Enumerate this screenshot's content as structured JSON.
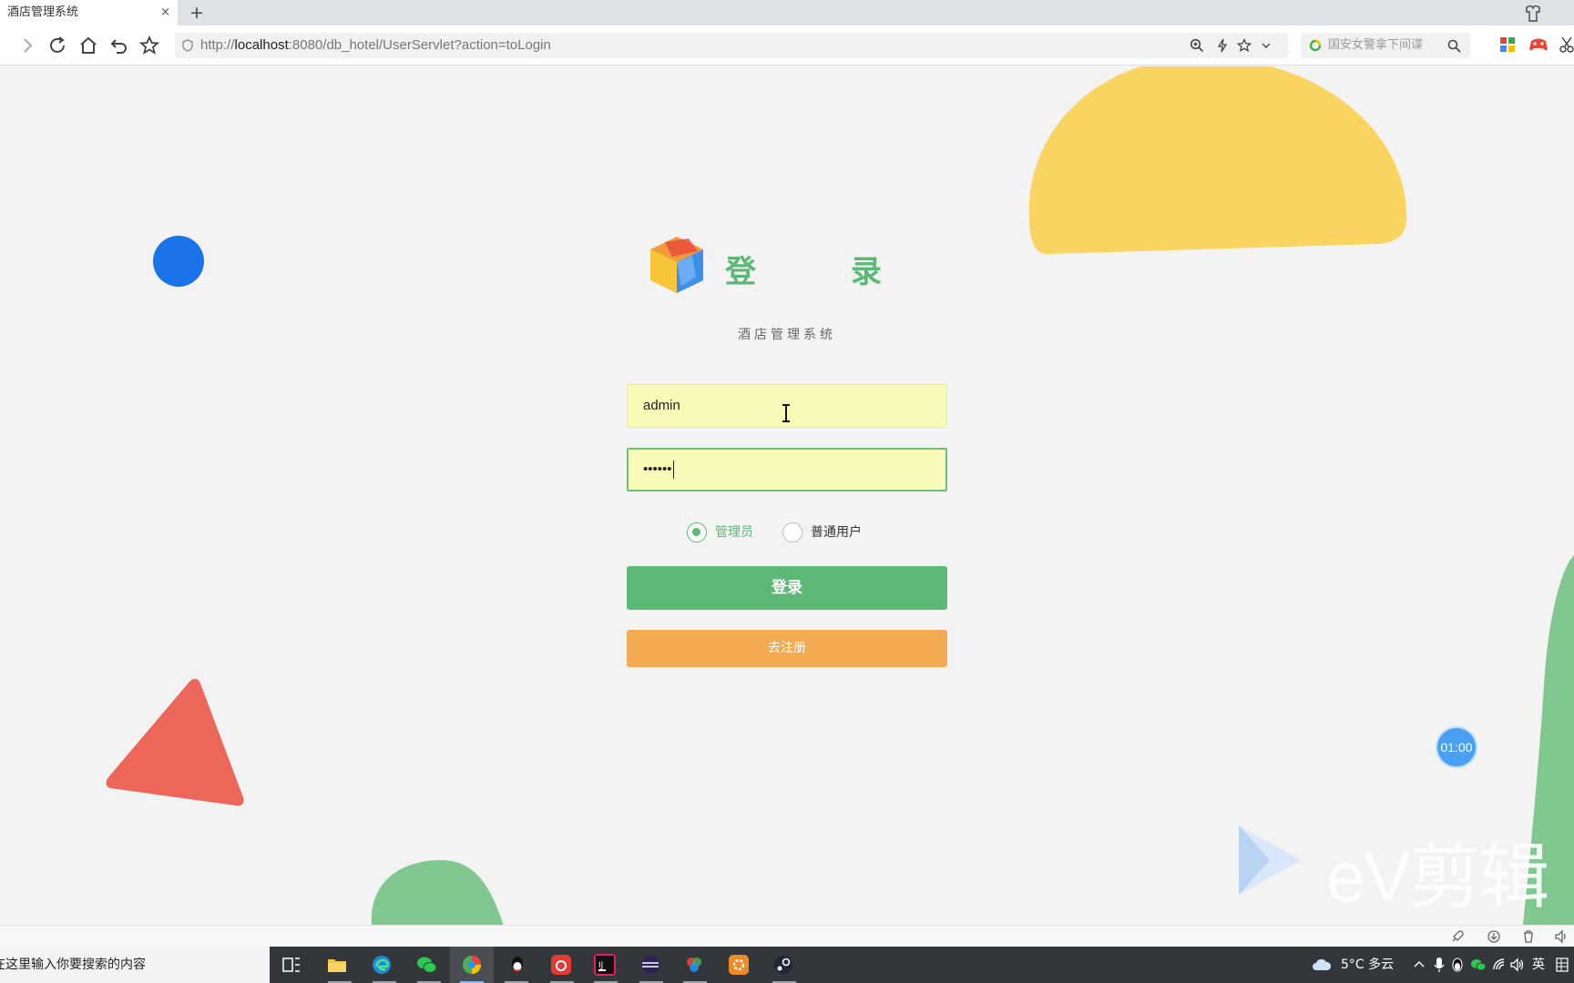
{
  "browser": {
    "tab_title": "酒店管理系统",
    "tab_close": "×",
    "new_tab": "+",
    "url_host": "localhost",
    "url_scheme": "http://",
    "url_rest": ":8080/db_hotel/UserServlet?action=toLogin",
    "search_placeholder": "国安女警拿下间谍"
  },
  "login": {
    "title": "登 录",
    "subtitle": "酒店管理系统",
    "username_value": "admin",
    "password_masked": "••••••",
    "roles": [
      {
        "label": "管理员",
        "selected": true
      },
      {
        "label": "普通用户",
        "selected": false
      }
    ],
    "login_button": "登录",
    "register_button": "去注册"
  },
  "overlay": {
    "timer": "01:00",
    "watermark": "eV剪辑"
  },
  "taskbar": {
    "search_text": "在这里输入你要搜索的内容",
    "weather": "5°C  多云",
    "ime": "英"
  },
  "colors": {
    "green": "#5cb874",
    "orange": "#f3aa50",
    "yellow": "#fad461",
    "blue": "#1a73e8",
    "red": "#ec6659",
    "input_bg": "#f8fab8"
  }
}
